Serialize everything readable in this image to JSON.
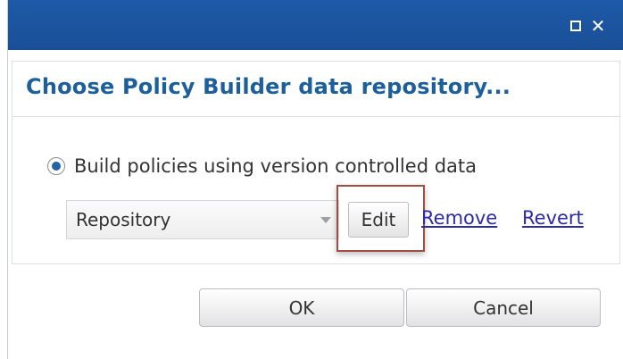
{
  "window": {
    "controls": {
      "maximize_icon": "maximize-icon",
      "close_icon": "close-icon",
      "close_glyph": "✕"
    },
    "title_color": "#1c5f9b",
    "titlebar_color": "#1a4f96"
  },
  "dialog": {
    "heading": "Choose Policy Builder data repository...",
    "option": {
      "label": "Build policies using version controlled data",
      "selected": true
    },
    "repository": {
      "selected_value": "Repository"
    },
    "actions": {
      "edit_label": "Edit",
      "remove_label": "Remove",
      "revert_label": "Revert"
    },
    "footer": {
      "ok_label": "OK",
      "cancel_label": "Cancel"
    }
  }
}
